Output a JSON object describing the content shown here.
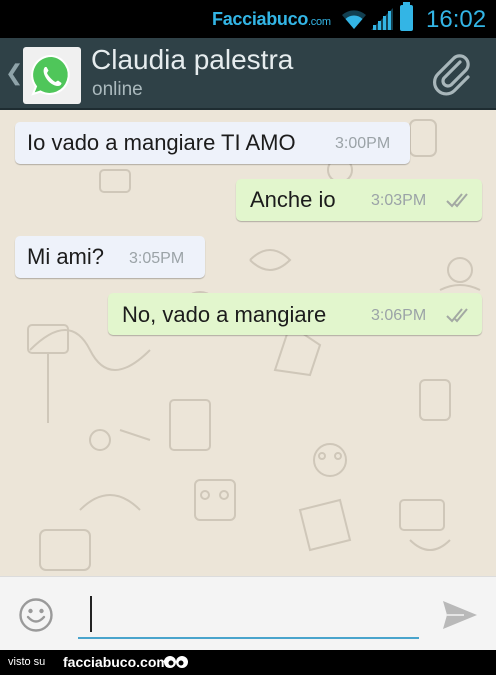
{
  "status_bar": {
    "watermark": "Facciabuco",
    "watermark_suffix": ".com",
    "time": "16:02",
    "icons": [
      "wifi-icon",
      "signal-icon",
      "battery-icon"
    ],
    "accent_color": "#33b5e5"
  },
  "header": {
    "contact_name": "Claudia palestra",
    "status": "online",
    "avatar_icon": "whatsapp-logo-icon",
    "attach_icon": "paperclip-icon",
    "background": "#2f4147"
  },
  "messages": [
    {
      "direction": "incoming",
      "text": "Io vado a mangiare TI AMO",
      "time": "3:00PM"
    },
    {
      "direction": "outgoing",
      "text": "Anche io",
      "time": "3:03PM",
      "ticks": "double-check-icon"
    },
    {
      "direction": "incoming",
      "text": "Mi ami?",
      "time": "3:05PM"
    },
    {
      "direction": "outgoing",
      "text": "No, vado a mangiare",
      "time": "3:06PM",
      "ticks": "double-check-icon"
    }
  ],
  "composer": {
    "value": "",
    "emoji_icon": "smiley-icon",
    "send_icon": "send-icon"
  },
  "footer": {
    "prefix": "visto su",
    "site": "facciabuco.com"
  },
  "colors": {
    "incoming_bubble": "#eef2fa",
    "outgoing_bubble": "#e2f6cd",
    "chat_background": "#ece5d8"
  }
}
